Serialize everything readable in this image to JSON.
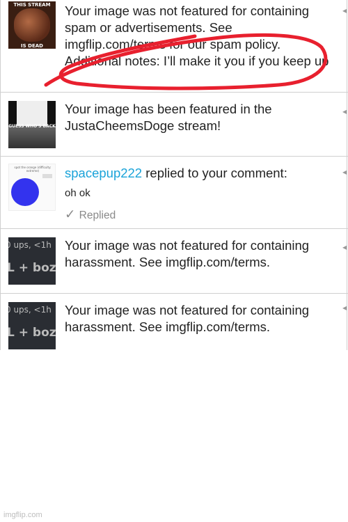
{
  "notifications": [
    {
      "thumb_caption_top": "THIS STREAM",
      "thumb_caption_bottom": "IS DEAD",
      "message": "Your image was not featured for containing spam or advertisements. See imgflip.com/terms for our spam policy. Additional notes: I’ll make it you if you keep up"
    },
    {
      "thumb_caption": "GUESS WHO'S BACK",
      "message": "Your image has been featured in the JustaCheemsDoge stream!"
    },
    {
      "thumb_caption": "spot the orange (difficulty: extreme)",
      "username": "spacepup222",
      "action": "replied to your comment:",
      "comment": "oh ok",
      "status": "Replied"
    },
    {
      "thumb_line1": "0 ups, <1h",
      "thumb_line2": "L + boz",
      "message": "Your image was not featured for containing harassment. See imgflip.com/terms."
    },
    {
      "thumb_line1": "0 ups, <1h",
      "thumb_line2": "L + boz",
      "message": "Your image was not featured for containing harassment. See imgflip.com/terms."
    }
  ],
  "caret_glyph": "◂",
  "check_glyph": "✓",
  "annotation_color": "#e8202e",
  "watermark": "imgflip.com"
}
